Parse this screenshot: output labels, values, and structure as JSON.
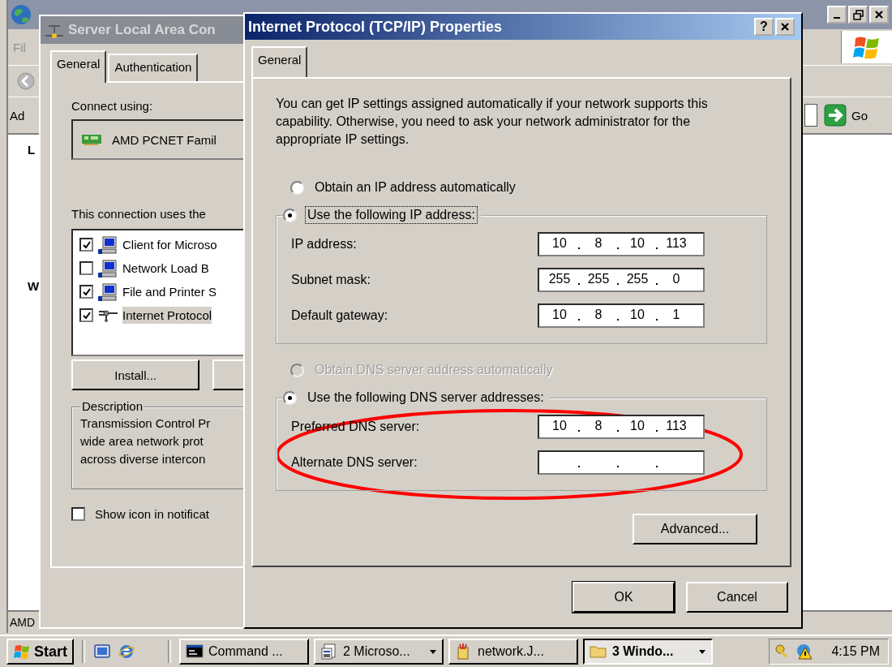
{
  "explorer": {
    "menu": "Fil",
    "address_label": "Ad",
    "go": "Go",
    "list_labels": [
      "L",
      "W"
    ],
    "status": "AMD"
  },
  "lan_dialog": {
    "title": "Server Local Area Con",
    "tabs": [
      {
        "label": "General",
        "selected": true
      },
      {
        "label": "Authentication",
        "selected": false
      }
    ],
    "connect_label": "Connect using:",
    "adapter": "AMD PCNET Famil",
    "components_label": "This connection uses the",
    "components": [
      {
        "label": "Client for Microso",
        "checked": true,
        "selected": false,
        "kind": "computer"
      },
      {
        "label": "Network Load B",
        "checked": false,
        "selected": false,
        "kind": "computer"
      },
      {
        "label": "File and Printer S",
        "checked": true,
        "selected": false,
        "kind": "computer"
      },
      {
        "label": "Internet Protocol",
        "checked": true,
        "selected": true,
        "kind": "protocol"
      }
    ],
    "install": "Install...",
    "description_label": "Description",
    "description_lines": [
      "Transmission Control Pr",
      "wide area network prot",
      "across diverse intercon"
    ],
    "show_icon": {
      "label": "Show icon in notificat",
      "checked": false
    }
  },
  "tcp_dialog": {
    "title": "Internet Protocol (TCP/IP) Properties",
    "help": "?",
    "tabs": [
      {
        "label": "General",
        "selected": true
      }
    ],
    "intro": "You can get IP settings assigned automatically if your network supports this capability. Otherwise, you need to ask your network administrator for the appropriate IP settings.",
    "ip_auto": {
      "label": "Obtain an IP address automatically",
      "selected": false,
      "disabled": false
    },
    "ip_manual": {
      "label": "Use the following IP address:",
      "selected": true,
      "disabled": false,
      "focused": true
    },
    "ip_fields": [
      {
        "label": "IP address:",
        "octets": [
          "10",
          "8",
          "10",
          "113"
        ]
      },
      {
        "label": "Subnet mask:",
        "octets": [
          "255",
          "255",
          "255",
          "0"
        ]
      },
      {
        "label": "Default gateway:",
        "octets": [
          "10",
          "8",
          "10",
          "1"
        ]
      }
    ],
    "dns_auto": {
      "label": "Obtain DNS server address automatically",
      "selected": false,
      "disabled": true
    },
    "dns_manual": {
      "label": "Use the following DNS server addresses:",
      "selected": true,
      "disabled": false,
      "focused": false
    },
    "dns_fields": [
      {
        "label": "Preferred DNS server:",
        "octets": [
          "10",
          "8",
          "10",
          "113"
        ]
      },
      {
        "label": "Alternate DNS server:"
      }
    ],
    "advanced": "Advanced...",
    "buttons": [
      "OK",
      "Cancel"
    ]
  },
  "highlight": {
    "kind": "ellipse"
  },
  "taskbar": {
    "start": "Start",
    "tasks": [
      {
        "label": "Command ...",
        "kind": "console",
        "dropdown": false,
        "selected": false
      },
      {
        "label": "2 Microso...",
        "kind": "documents",
        "dropdown": true,
        "selected": false
      },
      {
        "label": "network.J...",
        "kind": "paint",
        "dropdown": false,
        "selected": false
      },
      {
        "label": "3 Windo...",
        "kind": "folder",
        "dropdown": true,
        "selected": true
      }
    ],
    "clock": "4:15 PM"
  }
}
